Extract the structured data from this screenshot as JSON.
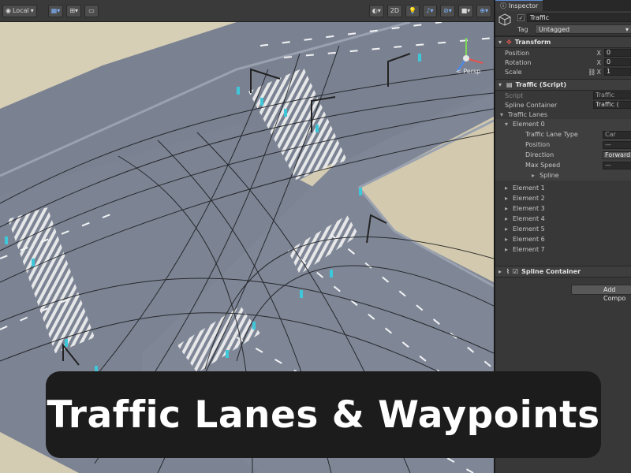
{
  "toolbar": {
    "pivot_label": "Local",
    "view_2d_label": "2D"
  },
  "scene": {
    "projection_label": "< Persp"
  },
  "inspector": {
    "tab_label": "Inspector",
    "gameobject_name": "Traffic",
    "tag_label": "Tag",
    "tag_value": "Untagged",
    "transform": {
      "title": "Transform",
      "position_label": "Position",
      "rotation_label": "Rotation",
      "scale_label": "Scale",
      "axis_x": "X",
      "position_x": "0",
      "rotation_x": "0",
      "scale_x": "1"
    },
    "traffic_script": {
      "title": "Traffic (Script)",
      "script_label": "Script",
      "script_value": "Traffic",
      "spline_container_label": "Spline Container",
      "spline_container_value": "Traffic (",
      "traffic_lanes_label": "Traffic Lanes",
      "element0": {
        "label": "Element 0",
        "lane_type_label": "Traffic Lane Type",
        "lane_type_value": "Car",
        "position_label": "Position",
        "position_value": "—",
        "direction_label": "Direction",
        "direction_value": "Forward",
        "max_speed_label": "Max Speed",
        "max_speed_value": "—",
        "spline_label": "Spline"
      },
      "elements": [
        "Element 1",
        "Element 2",
        "Element 3",
        "Element 4",
        "Element 5",
        "Element 6",
        "Element 7"
      ]
    },
    "spline_container": {
      "title": "Spline Container"
    },
    "add_component_label": "Add Compo"
  },
  "banner": {
    "title": "Traffic Lanes & Waypoints"
  },
  "colors": {
    "toolbar_bg": "#3a3a3a",
    "inspector_bg": "#383838",
    "road": "#7a8393",
    "sand": "#d2c9ae",
    "banner_bg": "#1c1c1c",
    "accent_blue": "#5b8ed6",
    "gizmo_cyan": "#3ec7d8"
  }
}
